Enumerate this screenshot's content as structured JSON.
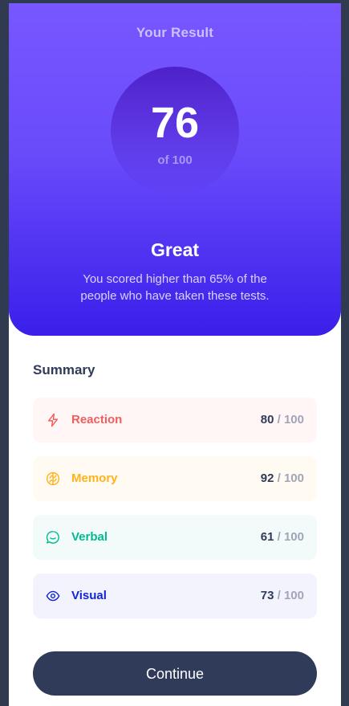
{
  "result": {
    "title": "Your Result",
    "score": "76",
    "of_label": "of 100",
    "rating": "Great",
    "message": "You scored higher than 65% of the people who have taken these tests."
  },
  "summary": {
    "title": "Summary",
    "items": [
      {
        "label": "Reaction",
        "score": "80",
        "separator": "/",
        "max": "100",
        "icon": "lightning-icon",
        "color": "#f25d5d"
      },
      {
        "label": "Memory",
        "score": "92",
        "separator": "/",
        "max": "100",
        "icon": "brain-icon",
        "color": "#ffb21e"
      },
      {
        "label": "Verbal",
        "score": "61",
        "separator": "/",
        "max": "100",
        "icon": "chat-bubble-icon",
        "color": "#00bb8f"
      },
      {
        "label": "Visual",
        "score": "73",
        "separator": "/",
        "max": "100",
        "icon": "eye-icon",
        "color": "#1125d4"
      }
    ]
  },
  "actions": {
    "continue_label": "Continue"
  },
  "colors": {
    "background": "#303b4f",
    "gradient_top": "#7857ff",
    "gradient_bottom": "#3a1fea",
    "button": "#303b5a"
  }
}
